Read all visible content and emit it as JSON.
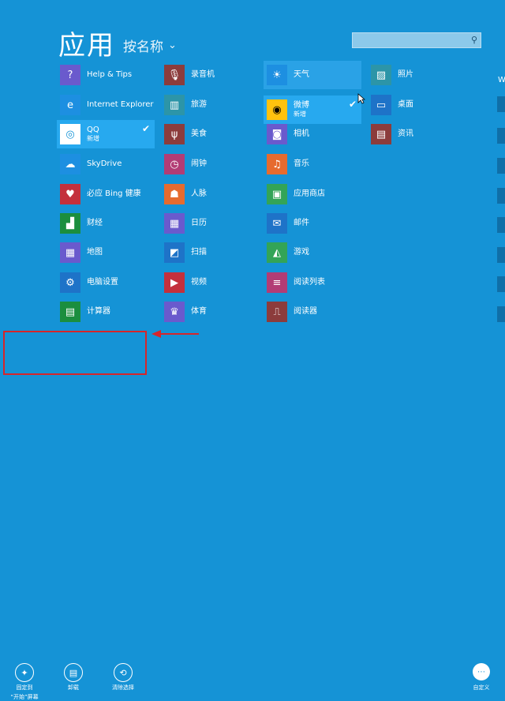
{
  "header": {
    "title": "应用",
    "sort_label": "按名称",
    "chevron": "chevron-down-icon",
    "search_icon": "⌕"
  },
  "columns": [
    [
      {
        "label": "Help & Tips",
        "icon": "?",
        "color": "purple"
      },
      {
        "label": "Internet Explorer",
        "icon": "e",
        "color": "lblue"
      },
      {
        "label": "QQ",
        "sub": "新增",
        "icon": "◎",
        "color": "white",
        "selected": true
      },
      {
        "label": "SkyDrive",
        "icon": "☁",
        "color": "lblue"
      },
      {
        "label": "必应 Bing 健康",
        "icon": "♥",
        "color": "red"
      },
      {
        "label": "财经",
        "icon": "▟",
        "color": "green"
      },
      {
        "label": "地图",
        "icon": "▦",
        "color": "purple"
      },
      {
        "label": "电脑设置",
        "icon": "⚙",
        "color": "blue"
      },
      {
        "label": "计算器",
        "icon": "▤",
        "color": "green"
      }
    ],
    [
      {
        "label": "录音机",
        "icon": "🎙",
        "color": "grayred"
      },
      {
        "label": "旅游",
        "icon": "▥",
        "color": "teal"
      },
      {
        "label": "美食",
        "icon": "ψ",
        "color": "grayred"
      },
      {
        "label": "闹钟",
        "icon": "◷",
        "color": "pink"
      },
      {
        "label": "人脉",
        "icon": "☗",
        "color": "orange"
      },
      {
        "label": "日历",
        "icon": "▦",
        "color": "purple"
      },
      {
        "label": "扫描",
        "icon": "◩",
        "color": "blue"
      },
      {
        "label": "视频",
        "icon": "▶",
        "color": "red"
      },
      {
        "label": "体育",
        "icon": "♛",
        "color": "purple"
      }
    ],
    [
      {
        "label": "天气",
        "icon": "☀",
        "color": "lblue",
        "hover": true
      },
      {
        "label": "微博",
        "sub": "新增",
        "icon": "◉",
        "color": "yel",
        "selected": true
      },
      {
        "label": "相机",
        "icon": "◙",
        "color": "purple"
      },
      {
        "label": "音乐",
        "icon": "♫",
        "color": "orange"
      },
      {
        "label": "应用商店",
        "icon": "▣",
        "color": "lgreen"
      },
      {
        "label": "邮件",
        "icon": "✉",
        "color": "blue"
      },
      {
        "label": "游戏",
        "icon": "◭",
        "color": "lgreen"
      },
      {
        "label": "阅读列表",
        "icon": "≡",
        "color": "pink"
      },
      {
        "label": "阅读器",
        "icon": "⎍",
        "color": "grayred"
      }
    ],
    [
      {
        "label": "照片",
        "icon": "▨",
        "color": "teal"
      },
      {
        "label": "桌面",
        "icon": "▭",
        "color": "blue"
      },
      {
        "label": "资讯",
        "icon": "▤",
        "color": "grayred"
      }
    ]
  ],
  "partial_column_letter": "W",
  "appbar": {
    "pin": {
      "label1": "固定到",
      "label2": "“开始”屏幕",
      "icon": "📌"
    },
    "uninstall": {
      "label": "卸载",
      "icon": "🗑"
    },
    "clear": {
      "label": "清除选择",
      "icon": "⟲"
    },
    "customize": {
      "label": "自定义",
      "icon": "⋯"
    }
  },
  "colors": {
    "background": "#1593D6",
    "selected_tile": "#27A9EF",
    "annotation_red": "#D7252A"
  }
}
